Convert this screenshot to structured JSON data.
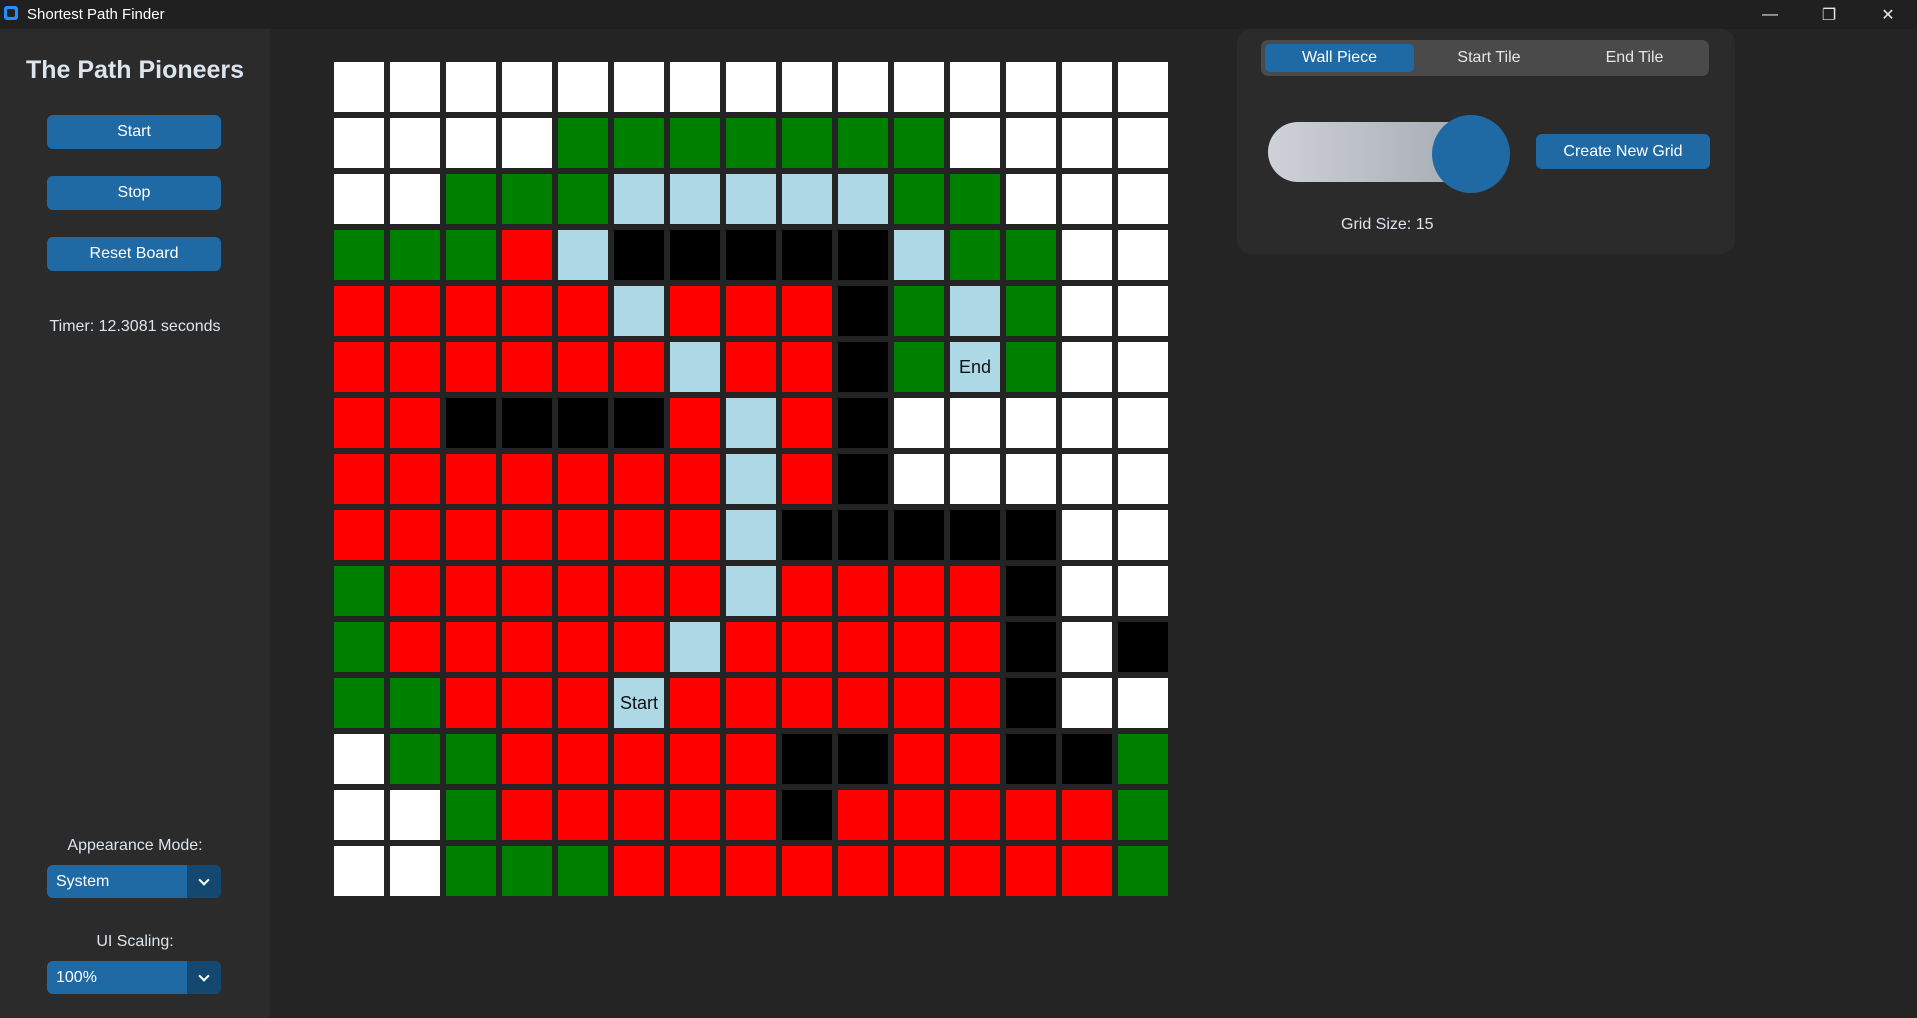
{
  "window": {
    "title": "Shortest Path Finder",
    "controls": [
      "minimize-icon",
      "restore-icon",
      "close-icon"
    ]
  },
  "sidebar": {
    "brand": "The Path Pioneers",
    "start_label": "Start",
    "stop_label": "Stop",
    "reset_label": "Reset Board",
    "timer_text": "Timer: 12.3081 seconds",
    "appearance_label": "Appearance Mode:",
    "appearance_value": "System",
    "scaling_label": "UI Scaling:",
    "scaling_value": "100%"
  },
  "panel": {
    "tabs": [
      "Wall Piece",
      "Start Tile",
      "End Tile"
    ],
    "active_tab": "Wall Piece",
    "slider_value": 15,
    "slider_fraction": 1.0,
    "create_label": "Create New Grid",
    "grid_size_text": "Grid Size: 15"
  },
  "colors": {
    "W": "#ffffff",
    "G": "#008000",
    "R": "#ff0000",
    "B": "#000000",
    "L": "#add8e6",
    "S": "#add8e6",
    "E": "#add8e6",
    "accent": "#1f6aa5"
  },
  "legend": {
    "W": "empty",
    "G": "frontier",
    "R": "visited",
    "B": "wall",
    "L": "path",
    "S": "start",
    "E": "end"
  },
  "tile_labels": {
    "S": "Start",
    "E": "End"
  },
  "grid": {
    "size": 15,
    "rows": [
      "WWWWWWWWWWWWWWW",
      "WWWWGGGGGGGWWWW",
      "WWGGGLLLLLGGWWW",
      "GGGRLBBBBBLGGWW",
      "RRRRRLRRRBGLGWW",
      "RRRRRRLRRBGEGWW",
      "RRBBBBRLRBWWWWW",
      "RRRRRRRLRBWWWWW",
      "RRRRRRRLBBBBBWW",
      "GRRRRRRLRRRRBWW",
      "GRRRRRLRRRRRBWB",
      "GGRRRSRRRRRRBWW",
      "WGGRRRRRBBRRBBG",
      "WWGRRRRRBRRRRRG",
      "WWGGGRRRRRRRRRG"
    ]
  }
}
